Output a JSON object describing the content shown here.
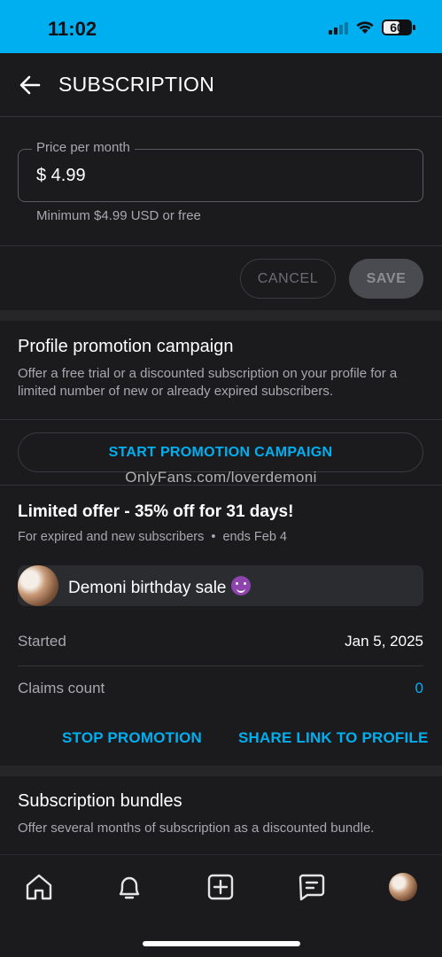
{
  "status_bar": {
    "time": "11:02",
    "battery": "60",
    "battery_level": 0.6
  },
  "header": {
    "title": "SUBSCRIPTION"
  },
  "price": {
    "label": "Price per month",
    "value": "$ 4.99",
    "hint": "Minimum $4.99 USD or free"
  },
  "actions": {
    "cancel": "CANCEL",
    "save": "SAVE"
  },
  "promotion": {
    "title": "Profile promotion campaign",
    "description": "Offer a free trial or a discounted subscription on your profile for a limited number of new or already expired subscribers.",
    "start_button": "START PROMOTION CAMPAIGN",
    "watermark": "OnlyFans.com/loverdemoni"
  },
  "offer": {
    "title": "Limited offer - 35% off for 31 days!",
    "audience": "For expired and new subscribers",
    "separator": "•",
    "ends": "ends Feb 4",
    "campaign_name": "Demoni birthday sale",
    "started_label": "Started",
    "started_value": "Jan 5, 2025",
    "claims_label": "Claims count",
    "claims_value": "0",
    "stop_button": "STOP PROMOTION",
    "share_button": "SHARE LINK TO PROFILE"
  },
  "bundles": {
    "title": "Subscription bundles",
    "description": "Offer several months of subscription as a discounted bundle."
  },
  "tab_bar": {
    "items": [
      "home-icon",
      "bell-icon",
      "add-post-icon",
      "messages-icon",
      "profile-avatar"
    ]
  },
  "colors": {
    "accent": "#00aff0",
    "background": "#1b1b1e"
  }
}
